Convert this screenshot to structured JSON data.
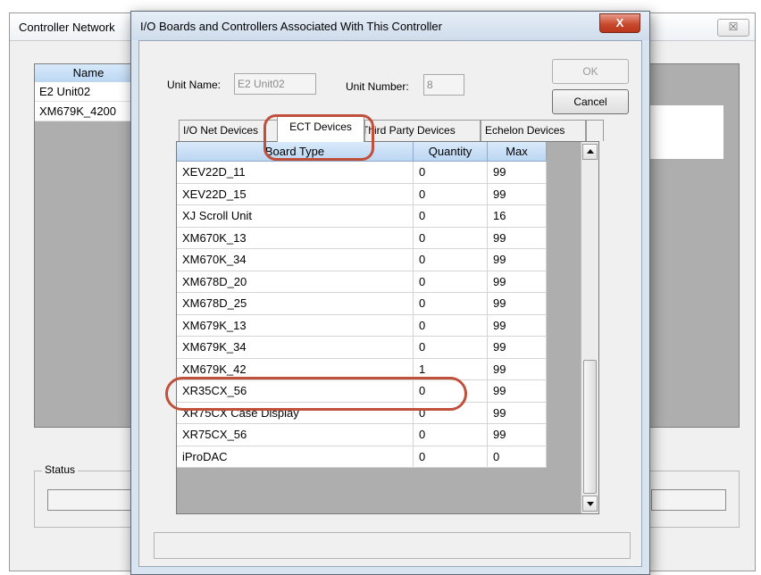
{
  "background_window": {
    "title": "Controller Network",
    "close_glyph": "☒",
    "list": {
      "header": "Name",
      "rows": [
        "E2 Unit02",
        "XM679K_4200"
      ]
    },
    "status_label": "Status"
  },
  "dialog": {
    "title": "I/O Boards and Controllers Associated With This Controller",
    "close_glyph": "X",
    "unit_name_label": "Unit Name:",
    "unit_name_value": "E2 Unit02",
    "unit_number_label": "Unit Number:",
    "unit_number_value": "8",
    "ok_label": "OK",
    "cancel_label": "Cancel",
    "tabs": [
      {
        "label": "I/O Net Devices",
        "active": false
      },
      {
        "label": "ECT Devices",
        "active": true
      },
      {
        "label": "Third Party Devices",
        "active": false
      },
      {
        "label": "Echelon Devices",
        "active": false
      }
    ],
    "grid": {
      "columns": [
        "Board Type",
        "Quantity",
        "Max"
      ],
      "rows": [
        {
          "type": "XEV22D_11",
          "quantity": "0",
          "max": "99"
        },
        {
          "type": "XEV22D_15",
          "quantity": "0",
          "max": "99"
        },
        {
          "type": "XJ Scroll Unit",
          "quantity": "0",
          "max": "16"
        },
        {
          "type": "XM670K_13",
          "quantity": "0",
          "max": "99"
        },
        {
          "type": "XM670K_34",
          "quantity": "0",
          "max": "99"
        },
        {
          "type": "XM678D_20",
          "quantity": "0",
          "max": "99"
        },
        {
          "type": "XM678D_25",
          "quantity": "0",
          "max": "99"
        },
        {
          "type": "XM679K_13",
          "quantity": "0",
          "max": "99"
        },
        {
          "type": "XM679K_34",
          "quantity": "0",
          "max": "99"
        },
        {
          "type": "XM679K_42",
          "quantity": "1",
          "max": "99"
        },
        {
          "type": "XR35CX_56",
          "quantity": "0",
          "max": "99"
        },
        {
          "type": "XR75CX Case Display",
          "quantity": "0",
          "max": "99"
        },
        {
          "type": "XR75CX_56",
          "quantity": "0",
          "max": "99"
        },
        {
          "type": "iProDAC",
          "quantity": "0",
          "max": "0"
        }
      ]
    }
  },
  "colors": {
    "callout": "#c0503c",
    "header_blue": "#c8e0f8",
    "grid_background": "#aeaeae"
  }
}
